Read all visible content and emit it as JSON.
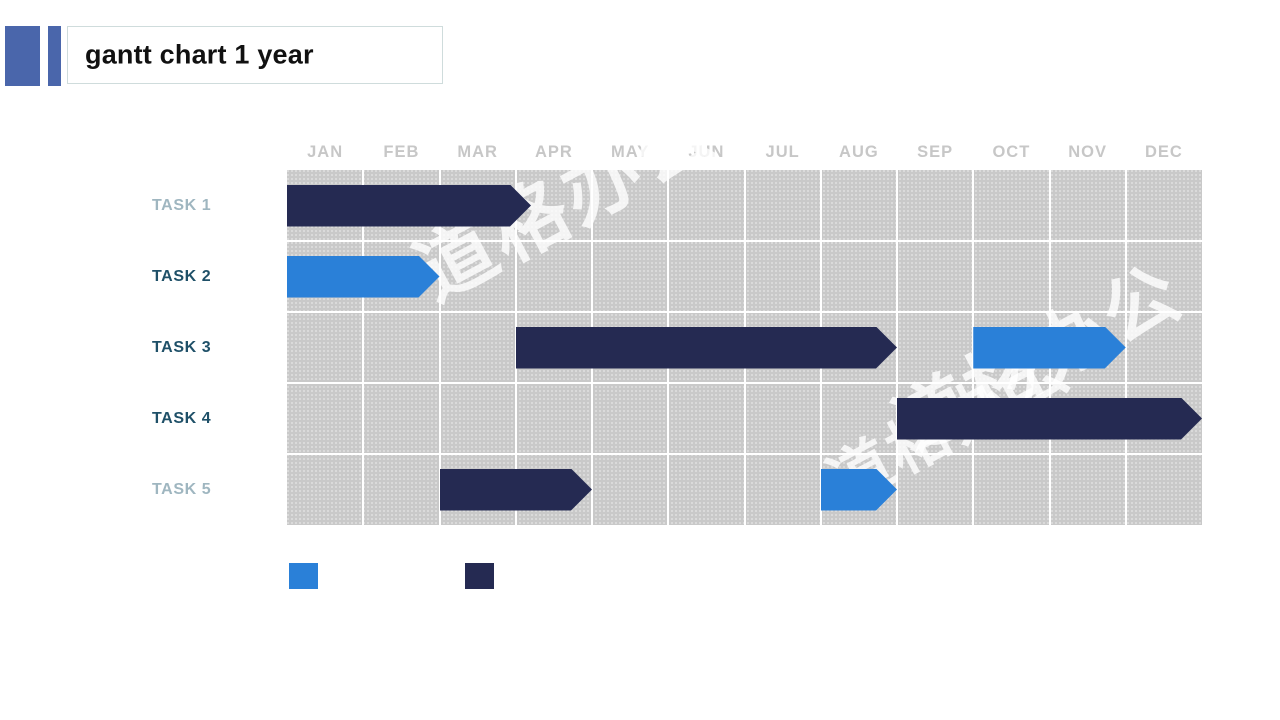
{
  "title": {
    "text": "gantt chart  1 year"
  },
  "colors": {
    "accent_block": "#4a66ab",
    "bar_dark": "#252a52",
    "bar_blue": "#2a80d8",
    "grid_background": "#c9c9c9",
    "grid_line": "#ffffff",
    "month_label": "#c7c7c7",
    "task_label": "#1f5068"
  },
  "watermark": {
    "lines": [
      "道格办公",
      "道格办公",
      "道格办公"
    ]
  },
  "legend": {
    "items": [
      {
        "name": "legend-blue",
        "color": "#2a80d8",
        "label": ""
      },
      {
        "name": "legend-dark",
        "color": "#252a52",
        "label": ""
      }
    ]
  },
  "chart_data": {
    "type": "bar",
    "subtype": "gantt",
    "title": "gantt chart  1 year",
    "xlabel": "",
    "ylabel": "",
    "categories": [
      "JAN",
      "FEB",
      "MAR",
      "APR",
      "MAY",
      "JUN",
      "JUL",
      "AUG",
      "SEP",
      "OCT",
      "NOV",
      "DEC"
    ],
    "tasks": [
      "TASK 1",
      "TASK 2",
      "TASK 3",
      "TASK 4",
      "TASK 5"
    ],
    "grid": true,
    "legend_position": "bottom-left",
    "xlim": [
      0,
      12
    ],
    "bars": [
      {
        "task": "TASK 1",
        "series": "dark",
        "color": "#252a52",
        "start_month": 0,
        "end_month": 3.2,
        "start_label": "JAN",
        "end_label": "APR"
      },
      {
        "task": "TASK 2",
        "series": "blue",
        "color": "#2a80d8",
        "start_month": 0,
        "end_month": 2.0,
        "start_label": "JAN",
        "end_label": "MAR"
      },
      {
        "task": "TASK 3",
        "series": "dark",
        "color": "#252a52",
        "start_month": 3.0,
        "end_month": 8.0,
        "start_label": "APR",
        "end_label": "SEP"
      },
      {
        "task": "TASK 3",
        "series": "blue",
        "color": "#2a80d8",
        "start_month": 9.0,
        "end_month": 11.0,
        "start_label": "OCT",
        "end_label": "DEC"
      },
      {
        "task": "TASK 4",
        "series": "dark",
        "color": "#252a52",
        "start_month": 8.0,
        "end_month": 12.0,
        "start_label": "SEP",
        "end_label": "DEC"
      },
      {
        "task": "TASK 5",
        "series": "dark",
        "color": "#252a52",
        "start_month": 2.0,
        "end_month": 4.0,
        "start_label": "MAR",
        "end_label": "MAY"
      },
      {
        "task": "TASK 5",
        "series": "blue",
        "color": "#2a80d8",
        "start_month": 7.0,
        "end_month": 8.0,
        "start_label": "AUG",
        "end_label": "SEP"
      }
    ],
    "series": [
      {
        "name": "dark",
        "color": "#252a52"
      },
      {
        "name": "blue",
        "color": "#2a80d8"
      }
    ]
  }
}
